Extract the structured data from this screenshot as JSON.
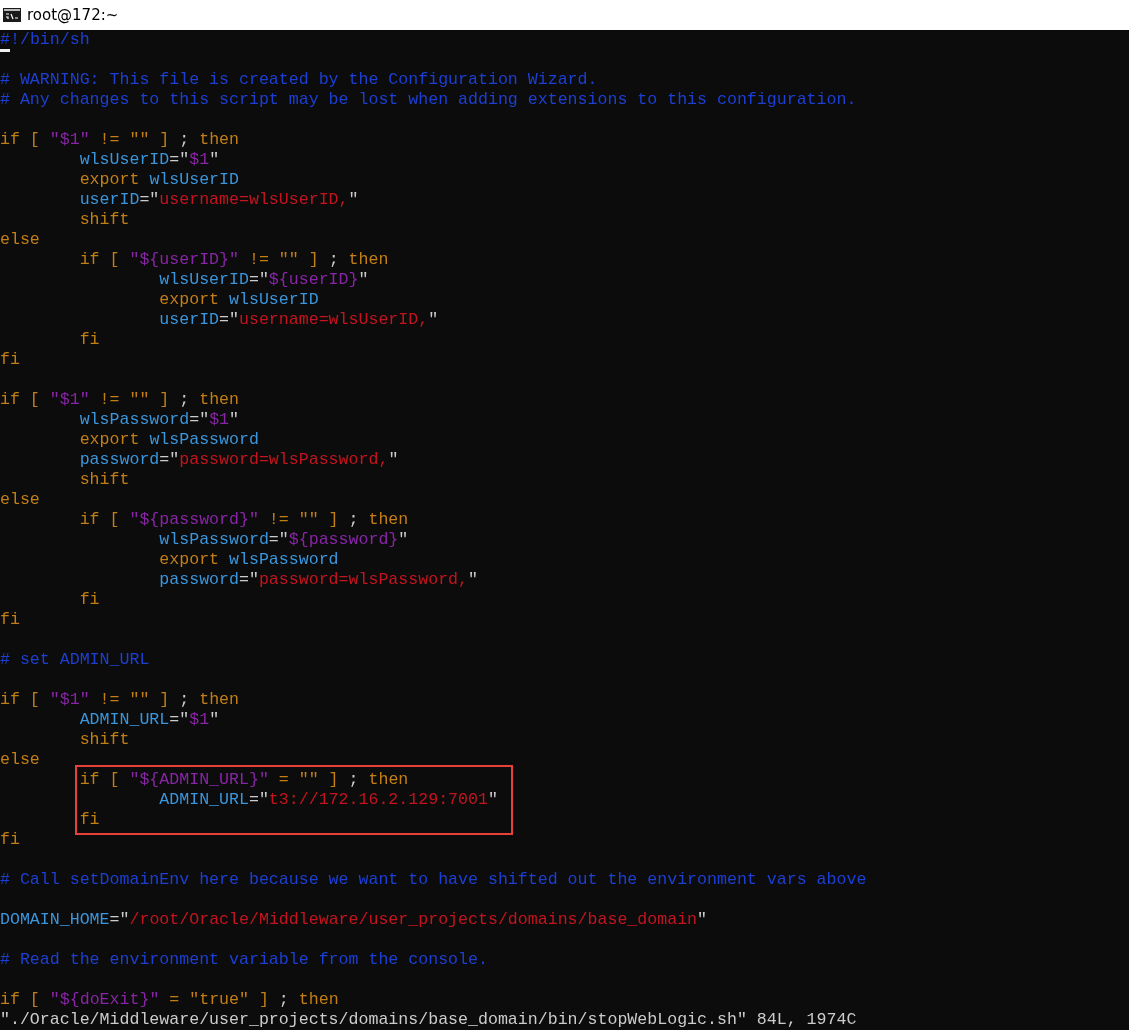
{
  "window": {
    "title": "root@172:~"
  },
  "lines": [
    {
      "kind": "code",
      "segments": [
        {
          "text": "#",
          "kind": "comment",
          "cursor": true
        },
        {
          "text": "!/bin/sh",
          "kind": "comment"
        }
      ]
    },
    {
      "kind": "blank"
    },
    {
      "kind": "code",
      "segments": [
        {
          "text": "# WARNING: This file is created by the Configuration Wizard.",
          "kind": "comment"
        }
      ]
    },
    {
      "kind": "code",
      "segments": [
        {
          "text": "# Any changes to this script may be lost when adding extensions to this configuration.",
          "kind": "comment"
        }
      ]
    },
    {
      "kind": "blank"
    },
    {
      "kind": "code",
      "segments": [
        {
          "text": "if [ ",
          "kind": "keyword"
        },
        {
          "text": "\"$1\"",
          "kind": "special"
        },
        {
          "text": " != \"\" ] ",
          "kind": "keyword"
        },
        {
          "text": ";",
          "kind": "plain"
        },
        {
          "text": " then",
          "kind": "keyword"
        }
      ]
    },
    {
      "kind": "block",
      "children": [
        {
          "kind": "code",
          "segments": [
            {
              "text": "wlsUserID",
              "kind": "variable"
            },
            {
              "text": "=\"",
              "kind": "plain"
            },
            {
              "text": "$1",
              "kind": "special"
            },
            {
              "text": "\"",
              "kind": "plain"
            }
          ]
        },
        {
          "kind": "code",
          "segments": [
            {
              "text": "export ",
              "kind": "keyword"
            },
            {
              "text": "wlsUserID",
              "kind": "variable"
            }
          ]
        },
        {
          "kind": "code",
          "segments": [
            {
              "text": "userID",
              "kind": "variable"
            },
            {
              "text": "=\"",
              "kind": "plain"
            },
            {
              "text": "username=wlsUserID,",
              "kind": "string"
            },
            {
              "text": "\"",
              "kind": "plain"
            }
          ]
        },
        {
          "kind": "code",
          "segments": [
            {
              "text": "shift",
              "kind": "keyword"
            }
          ]
        }
      ]
    },
    {
      "kind": "code",
      "segments": [
        {
          "text": "else",
          "kind": "keyword"
        }
      ]
    },
    {
      "kind": "block",
      "children": [
        {
          "kind": "code",
          "segments": [
            {
              "text": "if [ ",
              "kind": "keyword"
            },
            {
              "text": "\"${userID}\"",
              "kind": "special"
            },
            {
              "text": " != \"\" ] ",
              "kind": "keyword"
            },
            {
              "text": ";",
              "kind": "plain"
            },
            {
              "text": " then",
              "kind": "keyword"
            }
          ]
        },
        {
          "kind": "block",
          "children": [
            {
              "kind": "code",
              "segments": [
                {
                  "text": "wlsUserID",
                  "kind": "variable"
                },
                {
                  "text": "=\"",
                  "kind": "plain"
                },
                {
                  "text": "${userID}",
                  "kind": "special"
                },
                {
                  "text": "\"",
                  "kind": "plain"
                }
              ]
            },
            {
              "kind": "code",
              "segments": [
                {
                  "text": "export ",
                  "kind": "keyword"
                },
                {
                  "text": "wlsUserID",
                  "kind": "variable"
                }
              ]
            },
            {
              "kind": "code",
              "segments": [
                {
                  "text": "userID",
                  "kind": "variable"
                },
                {
                  "text": "=\"",
                  "kind": "plain"
                },
                {
                  "text": "username=wlsUserID,",
                  "kind": "string"
                },
                {
                  "text": "\"",
                  "kind": "plain"
                }
              ]
            }
          ]
        },
        {
          "kind": "code",
          "segments": [
            {
              "text": "fi",
              "kind": "keyword"
            }
          ]
        }
      ]
    },
    {
      "kind": "code",
      "segments": [
        {
          "text": "fi",
          "kind": "keyword"
        }
      ]
    },
    {
      "kind": "blank"
    },
    {
      "kind": "code",
      "segments": [
        {
          "text": "if [ ",
          "kind": "keyword"
        },
        {
          "text": "\"$1\"",
          "kind": "special"
        },
        {
          "text": " != \"\" ] ",
          "kind": "keyword"
        },
        {
          "text": ";",
          "kind": "plain"
        },
        {
          "text": " then",
          "kind": "keyword"
        }
      ]
    },
    {
      "kind": "block",
      "children": [
        {
          "kind": "code",
          "segments": [
            {
              "text": "wlsPassword",
              "kind": "variable"
            },
            {
              "text": "=\"",
              "kind": "plain"
            },
            {
              "text": "$1",
              "kind": "special"
            },
            {
              "text": "\"",
              "kind": "plain"
            }
          ]
        },
        {
          "kind": "code",
          "segments": [
            {
              "text": "export ",
              "kind": "keyword"
            },
            {
              "text": "wlsPassword",
              "kind": "variable"
            }
          ]
        },
        {
          "kind": "code",
          "segments": [
            {
              "text": "password",
              "kind": "variable"
            },
            {
              "text": "=\"",
              "kind": "plain"
            },
            {
              "text": "password=wlsPassword,",
              "kind": "string"
            },
            {
              "text": "\"",
              "kind": "plain"
            }
          ]
        },
        {
          "kind": "code",
          "segments": [
            {
              "text": "shift",
              "kind": "keyword"
            }
          ]
        }
      ]
    },
    {
      "kind": "code",
      "segments": [
        {
          "text": "else",
          "kind": "keyword"
        }
      ]
    },
    {
      "kind": "block",
      "children": [
        {
          "kind": "code",
          "segments": [
            {
              "text": "if [ ",
              "kind": "keyword"
            },
            {
              "text": "\"${password}\"",
              "kind": "special"
            },
            {
              "text": " != \"\" ] ",
              "kind": "keyword"
            },
            {
              "text": ";",
              "kind": "plain"
            },
            {
              "text": " then",
              "kind": "keyword"
            }
          ]
        },
        {
          "kind": "block",
          "children": [
            {
              "kind": "code",
              "segments": [
                {
                  "text": "wlsPassword",
                  "kind": "variable"
                },
                {
                  "text": "=\"",
                  "kind": "plain"
                },
                {
                  "text": "${password}",
                  "kind": "special"
                },
                {
                  "text": "\"",
                  "kind": "plain"
                }
              ]
            },
            {
              "kind": "code",
              "segments": [
                {
                  "text": "export ",
                  "kind": "keyword"
                },
                {
                  "text": "wlsPassword",
                  "kind": "variable"
                }
              ]
            },
            {
              "kind": "code",
              "segments": [
                {
                  "text": "password",
                  "kind": "variable"
                },
                {
                  "text": "=\"",
                  "kind": "plain"
                },
                {
                  "text": "password=wlsPassword,",
                  "kind": "string"
                },
                {
                  "text": "\"",
                  "kind": "plain"
                }
              ]
            }
          ]
        },
        {
          "kind": "code",
          "segments": [
            {
              "text": "fi",
              "kind": "keyword"
            }
          ]
        }
      ]
    },
    {
      "kind": "code",
      "segments": [
        {
          "text": "fi",
          "kind": "keyword"
        }
      ]
    },
    {
      "kind": "blank"
    },
    {
      "kind": "code",
      "segments": [
        {
          "text": "# set ADMIN_URL",
          "kind": "comment"
        }
      ]
    },
    {
      "kind": "blank"
    },
    {
      "kind": "code",
      "segments": [
        {
          "text": "if [ ",
          "kind": "keyword"
        },
        {
          "text": "\"$1\"",
          "kind": "special"
        },
        {
          "text": " != \"\" ] ",
          "kind": "keyword"
        },
        {
          "text": ";",
          "kind": "plain"
        },
        {
          "text": " then",
          "kind": "keyword"
        }
      ]
    },
    {
      "kind": "block",
      "children": [
        {
          "kind": "code",
          "segments": [
            {
              "text": "ADMIN_URL",
              "kind": "variable"
            },
            {
              "text": "=\"",
              "kind": "plain"
            },
            {
              "text": "$1",
              "kind": "special"
            },
            {
              "text": "\"",
              "kind": "plain"
            }
          ]
        },
        {
          "kind": "code",
          "segments": [
            {
              "text": "shift",
              "kind": "keyword"
            }
          ]
        }
      ]
    },
    {
      "kind": "code",
      "segments": [
        {
          "text": "else",
          "kind": "keyword"
        }
      ]
    },
    {
      "kind": "block",
      "children": [
        {
          "kind": "boxed",
          "children": [
            {
              "kind": "code",
              "segments": [
                {
                  "text": "if [ ",
                  "kind": "keyword"
                },
                {
                  "text": "\"${ADMIN_URL}\"",
                  "kind": "special"
                },
                {
                  "text": " = \"\" ] ",
                  "kind": "keyword"
                },
                {
                  "text": ";",
                  "kind": "plain"
                },
                {
                  "text": " then",
                  "kind": "keyword"
                }
              ]
            },
            {
              "kind": "block",
              "children": [
                {
                  "kind": "code",
                  "segments": [
                    {
                      "text": "ADMIN_URL",
                      "kind": "variable"
                    },
                    {
                      "text": "=\"",
                      "kind": "plain"
                    },
                    {
                      "text": "t3://172.16.2.129:7001",
                      "kind": "string"
                    },
                    {
                      "text": "\"",
                      "kind": "plain"
                    }
                  ]
                }
              ]
            },
            {
              "kind": "code",
              "segments": [
                {
                  "text": "fi",
                  "kind": "keyword"
                }
              ]
            }
          ]
        }
      ]
    },
    {
      "kind": "code",
      "segments": [
        {
          "text": "fi",
          "kind": "keyword"
        }
      ]
    },
    {
      "kind": "blank"
    },
    {
      "kind": "code",
      "segments": [
        {
          "text": "# Call setDomainEnv here because we want to have shifted out the environment vars above",
          "kind": "comment"
        }
      ]
    },
    {
      "kind": "blank"
    },
    {
      "kind": "code",
      "segments": [
        {
          "text": "DOMAIN_HOME",
          "kind": "variable"
        },
        {
          "text": "=\"",
          "kind": "plain"
        },
        {
          "text": "/root/Oracle/Middleware/user_projects/domains/base_domain",
          "kind": "string"
        },
        {
          "text": "\"",
          "kind": "plain"
        }
      ]
    },
    {
      "kind": "blank"
    },
    {
      "kind": "code",
      "segments": [
        {
          "text": "# Read the environment variable from the console.",
          "kind": "comment"
        }
      ]
    },
    {
      "kind": "blank"
    },
    {
      "kind": "code",
      "segments": [
        {
          "text": "if [ ",
          "kind": "keyword"
        },
        {
          "text": "\"${doExit}\"",
          "kind": "special"
        },
        {
          "text": " = \"true\" ] ",
          "kind": "keyword"
        },
        {
          "text": ";",
          "kind": "plain"
        },
        {
          "text": " then",
          "kind": "keyword"
        }
      ]
    }
  ],
  "status_line": "\"./Oracle/Middleware/user_projects/domains/base_domain/bin/stopWebLogic.sh\" 84L, 1974C"
}
